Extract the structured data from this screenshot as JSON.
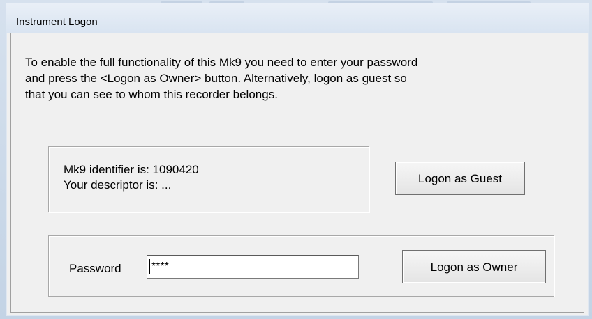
{
  "window": {
    "title": "Instrument Logon"
  },
  "intro": {
    "line1": "To enable the full functionality of this Mk9 you need to enter your password",
    "line2": "and press the <Logon as Owner> button.  Alternatively, logon as guest so",
    "line3": "that you can see to whom this recorder belongs."
  },
  "identity": {
    "identifier_line": "Mk9 identifier is:  1090420",
    "descriptor_line": "Your descriptor is:  ..."
  },
  "buttons": {
    "guest_label": "Logon as Guest",
    "owner_label": "Logon as Owner"
  },
  "password": {
    "label": "Password",
    "value": "****"
  }
}
